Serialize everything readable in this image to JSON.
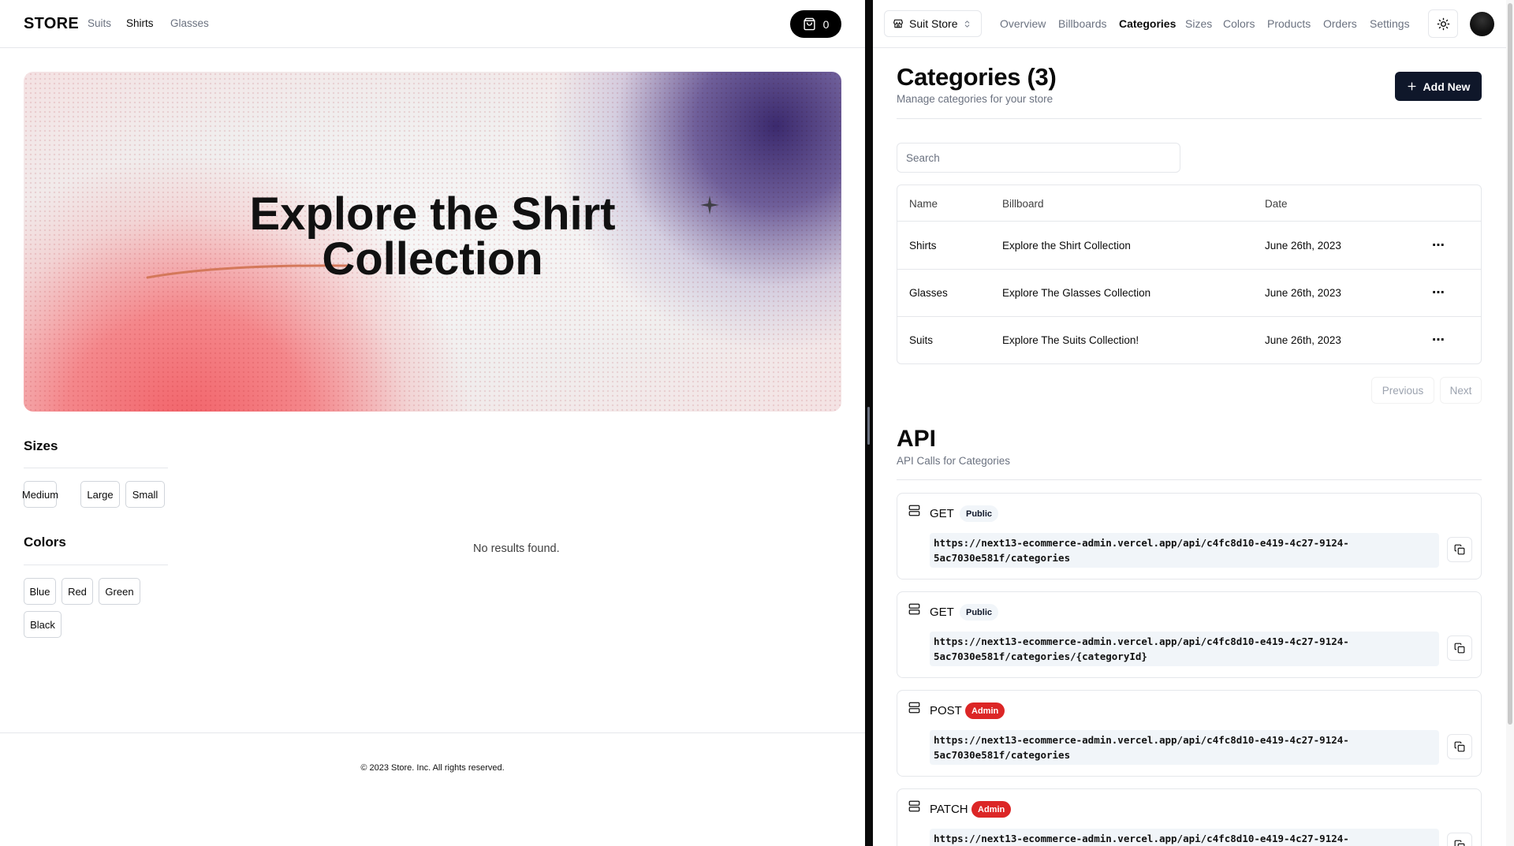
{
  "store": {
    "brand": "STORE",
    "nav": [
      {
        "label": "Suits",
        "active": false
      },
      {
        "label": "Shirts",
        "active": true
      },
      {
        "label": "Glasses",
        "active": false
      }
    ],
    "cart_count": "0",
    "billboard": {
      "title": "Explore the Shirt\nCollection"
    },
    "sizes_heading": "Sizes",
    "sizes": [
      "Medium",
      "Large",
      "Small"
    ],
    "colors_heading": "Colors",
    "colors": [
      "Blue",
      "Red",
      "Green",
      "Black"
    ],
    "no_results": "No results found.",
    "footer": "© 2023 Store. Inc. All rights reserved."
  },
  "admin": {
    "store_switcher": "Suit Store",
    "nav": [
      {
        "label": "Overview",
        "active": false
      },
      {
        "label": "Billboards",
        "active": false
      },
      {
        "label": "Categories",
        "active": true
      },
      {
        "label": "Sizes",
        "active": false
      },
      {
        "label": "Colors",
        "active": false
      },
      {
        "label": "Products",
        "active": false
      },
      {
        "label": "Orders",
        "active": false
      },
      {
        "label": "Settings",
        "active": false
      }
    ],
    "title": "Categories (3)",
    "subtitle": "Manage categories for your store",
    "add_button": "Add New",
    "search_placeholder": "Search",
    "table": {
      "columns": [
        "Name",
        "Billboard",
        "Date"
      ],
      "rows": [
        {
          "name": "Shirts",
          "billboard": "Explore the Shirt Collection",
          "date": "June 26th, 2023"
        },
        {
          "name": "Glasses",
          "billboard": "Explore The Glasses Collection",
          "date": "June 26th, 2023"
        },
        {
          "name": "Suits",
          "billboard": "Explore The Suits Collection!",
          "date": "June 26th, 2023"
        }
      ],
      "row_action": "⋯"
    },
    "pagination": {
      "previous": "Previous",
      "next": "Next"
    },
    "api": {
      "title": "API",
      "subtitle": "API Calls for Categories",
      "calls": [
        {
          "method": "GET",
          "access": "Public",
          "url": "https://next13-ecommerce-admin.vercel.app/api/c4fc8d10-e419-4c27-9124-5ac7030e581f/categories"
        },
        {
          "method": "GET",
          "access": "Public",
          "url": "https://next13-ecommerce-admin.vercel.app/api/c4fc8d10-e419-4c27-9124-5ac7030e581f/categories/{categoryId}"
        },
        {
          "method": "POST",
          "access": "Admin",
          "url": "https://next13-ecommerce-admin.vercel.app/api/c4fc8d10-e419-4c27-9124-5ac7030e581f/categories"
        },
        {
          "method": "PATCH",
          "access": "Admin",
          "url": "https://next13-ecommerce-admin.vercel.app/api/c4fc8d10-e419-4c27-9124-"
        }
      ]
    }
  },
  "colors": {
    "primary": "#0f172a",
    "admin_badge": "#dc2626",
    "public_badge": "#f1f5f9",
    "muted_text": "#6b7280"
  }
}
